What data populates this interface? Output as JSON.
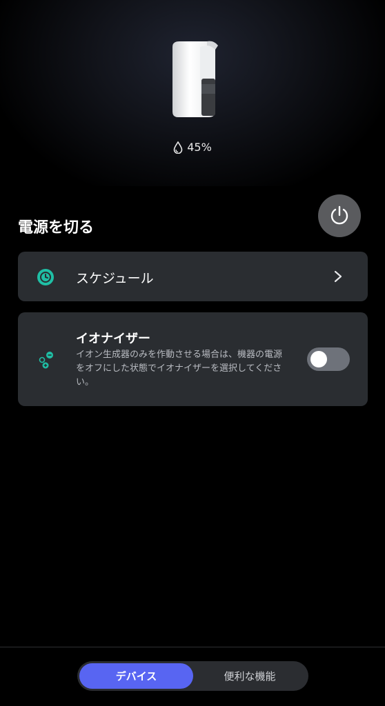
{
  "device": {
    "image": "air-purifier-icon",
    "humidity_icon": "water-drop-icon",
    "humidity": "45%"
  },
  "power": {
    "label": "電源を切る",
    "icon": "power-icon"
  },
  "schedule": {
    "icon": "clock-icon",
    "label": "スケジュール",
    "chevron_icon": "chevron-right-icon"
  },
  "ionizer": {
    "icon": "ion-icon",
    "title": "イオナイザー",
    "description": "イオン生成器のみを作動させる場合は、機器の電源をオフにした状態でイオナイザーを選択してください。",
    "enabled": false
  },
  "tabs": [
    {
      "label": "デバイス",
      "active": true
    },
    {
      "label": "便利な機能",
      "active": false
    }
  ],
  "colors": {
    "accent": "#5865f2",
    "teal": "#1fbfa5",
    "card": "#2a2d31"
  }
}
